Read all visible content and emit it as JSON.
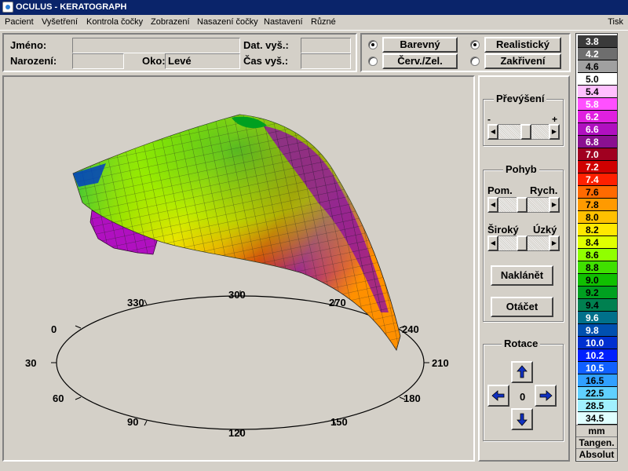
{
  "window": {
    "title": "OCULUS - KERATOGRAPH"
  },
  "menu": [
    "Pacient",
    "Vyšetření",
    "Kontrola čočky",
    "Zobrazení",
    "Nasazení čočky",
    "Nastavení",
    "Různé"
  ],
  "menu_right": "Tisk",
  "patient": {
    "name_label": "Jméno:",
    "name_value": "",
    "birth_label": "Narození:",
    "birth_value": "",
    "eye_label": "Oko:",
    "eye_value": "Levé",
    "exam_date_label": "Dat. vyš.:",
    "exam_date_value": "",
    "exam_time_label": "Čas vyš.:",
    "exam_time_value": ""
  },
  "display": {
    "color_mode": [
      "Barevný",
      "Červ./Zel."
    ],
    "color_mode_selected": 0,
    "render_mode": [
      "Realistický",
      "Zakřivení"
    ],
    "render_mode_selected": 0
  },
  "controls": {
    "elevation_title": "Převýšení",
    "elevation_minus": "-",
    "elevation_plus": "+",
    "elevation_level": 0.55,
    "motion_title": "Pohyb",
    "slow_label": "Pom.",
    "fast_label": "Rych.",
    "speed_level": 0.45,
    "wide_label": "Široký",
    "narrow_label": "Úzký",
    "width_level": 0.45,
    "tilt_button": "Naklánět",
    "rotate_button": "Otáčet",
    "rotation_title": "Rotace",
    "rotation_value": "0"
  },
  "axis_labels": [
    "0",
    "30",
    "60",
    "90",
    "120",
    "150",
    "180",
    "210",
    "240",
    "270",
    "300",
    "330"
  ],
  "scale": {
    "values": [
      "3.8",
      "4.2",
      "4.6",
      "5.0",
      "5.4",
      "5.8",
      "6.2",
      "6.6",
      "6.8",
      "7.0",
      "7.2",
      "7.4",
      "7.6",
      "7.8",
      "8.0",
      "8.2",
      "8.4",
      "8.6",
      "8.8",
      "9.0",
      "9.2",
      "9.4",
      "9.6",
      "9.8",
      "10.0",
      "10.2",
      "10.5",
      "16.5",
      "22.5",
      "28.5",
      "34.5"
    ],
    "colors": [
      "#3a3a3a",
      "#6e6e6e",
      "#a0a0a0",
      "#ffffff",
      "#ffc0ff",
      "#ff50ff",
      "#e020e0",
      "#b010c0",
      "#8a1090",
      "#a00020",
      "#d00000",
      "#ff2000",
      "#ff6a00",
      "#ff9a00",
      "#ffc000",
      "#ffe800",
      "#e0ff00",
      "#90ff00",
      "#40e000",
      "#10c000",
      "#00a020",
      "#008050",
      "#00708a",
      "#0050b0",
      "#0030d0",
      "#0020ff",
      "#1060ff",
      "#30a0ff",
      "#60d0ff",
      "#a0f0ff",
      "#e0ffff"
    ],
    "unit": "mm",
    "mode1": "Tangen.",
    "mode2": "Absolut"
  }
}
